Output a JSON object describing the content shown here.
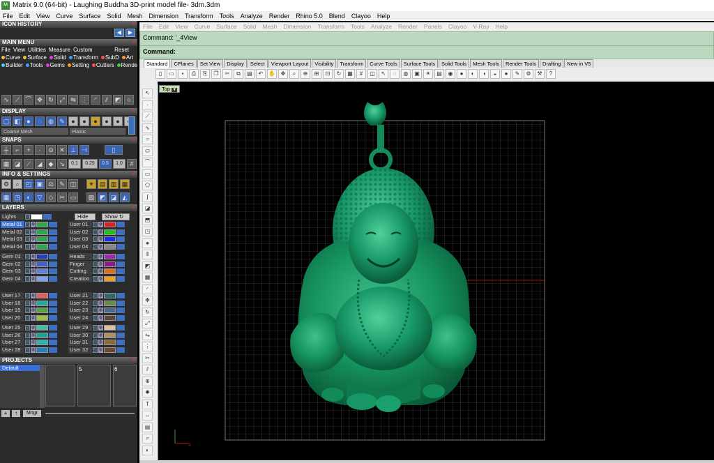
{
  "window": {
    "title": "Matrix 9.0 (64-bit) - Laughing Buddha 3D-print model file- 3dm.3dm"
  },
  "menubar": [
    "File",
    "Edit",
    "View",
    "Curve",
    "Surface",
    "Solid",
    "Mesh",
    "Dimension",
    "Transform",
    "Tools",
    "Analyze",
    "Render",
    "Rhino 5.0",
    "Blend",
    "Clayoo",
    "Help"
  ],
  "rhino_menu": [
    "File",
    "Edit",
    "View",
    "Curve",
    "Surface",
    "Solid",
    "Mesh",
    "Dimension",
    "Transform",
    "Tools",
    "Analyze",
    "Render",
    "Panels",
    "Clayoo",
    "V-Ray",
    "Help"
  ],
  "command": {
    "line1": "Command: '_4View",
    "line2": "Command:"
  },
  "tabs": [
    "Standard",
    "CPlanes",
    "Set View",
    "Display",
    "Select",
    "Viewport Layout",
    "Visibility",
    "Transform",
    "Curve Tools",
    "Surface Tools",
    "Solid Tools",
    "Mesh Tools",
    "Render Tools",
    "Drafting",
    "New in V5"
  ],
  "viewport": {
    "label": "Top"
  },
  "panels": {
    "icon_history": "ICON HISTORY",
    "main_menu": "MAIN MENU",
    "display": "DISPLAY",
    "snaps": "SNAPS",
    "info": "INFO & SETTINGS",
    "layers": "LAYERS",
    "projects": "PROJECTS"
  },
  "main_menu_rows": {
    "row1": [
      "File",
      "View",
      "Utilities",
      "Measure",
      "Custom",
      "Reset"
    ],
    "row2": [
      {
        "label": "Curve",
        "color": "#e8c440"
      },
      {
        "label": "Surface",
        "color": "#e8c440"
      },
      {
        "label": "Solid",
        "color": "#e040e0"
      },
      {
        "label": "Transform",
        "color": "#40a0ff"
      },
      {
        "label": "SubD",
        "color": "#ff5050"
      },
      {
        "label": "Art",
        "color": "#ff9a30"
      }
    ],
    "row3": [
      {
        "label": "Builder",
        "color": "#40d0ff"
      },
      {
        "label": "Tools",
        "color": "#40a0ff"
      },
      {
        "label": "Gems",
        "color": "#e040e0"
      },
      {
        "label": "Setting",
        "color": "#ffa020"
      },
      {
        "label": "Cutters",
        "color": "#ff5050"
      },
      {
        "label": "Render",
        "color": "#40d040"
      }
    ]
  },
  "display_selects": {
    "mesh": "Coarse Mesh",
    "material": "Plastic"
  },
  "snap_values": [
    "0.1",
    "0.25",
    "0.5",
    "1.0"
  ],
  "layers": {
    "lights": "Lights",
    "hide": "Hide",
    "show": "Show",
    "groups": [
      {
        "left": [
          {
            "name": "Metal 01",
            "color": "#2ea84f",
            "sel": true
          },
          {
            "name": "Metal 02",
            "color": "#2ea84f"
          },
          {
            "name": "Metal 03",
            "color": "#2ea84f"
          },
          {
            "name": "Metal 04",
            "color": "#2ea84f"
          }
        ],
        "right": [
          {
            "name": "User 01",
            "color": "#e02020"
          },
          {
            "name": "User 02",
            "color": "#20c020"
          },
          {
            "name": "User 03",
            "color": "#1a2fe0"
          },
          {
            "name": "User 04",
            "color": "#888888"
          }
        ]
      },
      {
        "left": [
          {
            "name": "Gem 01",
            "color": "#2040c0"
          },
          {
            "name": "Gem 02",
            "color": "#4060d0"
          },
          {
            "name": "Gem 03",
            "color": "#6080e0"
          },
          {
            "name": "Gem 04",
            "color": "#80a0f0"
          }
        ],
        "right": [
          {
            "name": "Heads",
            "color": "#9a2ab0"
          },
          {
            "name": "Finger",
            "color": "#8a1a8a"
          },
          {
            "name": "Cutting",
            "color": "#e07020"
          },
          {
            "name": "Creation",
            "color": "#f0a020"
          }
        ]
      },
      {
        "left": [
          {
            "name": "User 17",
            "color": "#e06060"
          },
          {
            "name": "User 18",
            "color": "#2aa8a0"
          },
          {
            "name": "User 19",
            "color": "#5aa040"
          },
          {
            "name": "User 20",
            "color": "#a0c040"
          }
        ],
        "right": [
          {
            "name": "User 21",
            "color": "#2a6a6a"
          },
          {
            "name": "User 22",
            "color": "#6a8a4a"
          },
          {
            "name": "User 23",
            "color": "#4a6a8a"
          },
          {
            "name": "User 24",
            "color": "#5a4a3a"
          }
        ]
      },
      {
        "left": [
          {
            "name": "User 25",
            "color": "#40c0a0"
          },
          {
            "name": "User 26",
            "color": "#20a090"
          },
          {
            "name": "User 27",
            "color": "#30b0b0"
          },
          {
            "name": "User 28",
            "color": "#2080c0"
          }
        ],
        "right": [
          {
            "name": "User 29",
            "color": "#d8c0a0"
          },
          {
            "name": "User 30",
            "color": "#b09060"
          },
          {
            "name": "User 31",
            "color": "#8a6a3a"
          },
          {
            "name": "User 32",
            "color": "#6a4a2a"
          }
        ]
      }
    ]
  },
  "projects": {
    "default": "Default",
    "slots": [
      "5",
      "6"
    ],
    "mngr": "Mngr"
  }
}
